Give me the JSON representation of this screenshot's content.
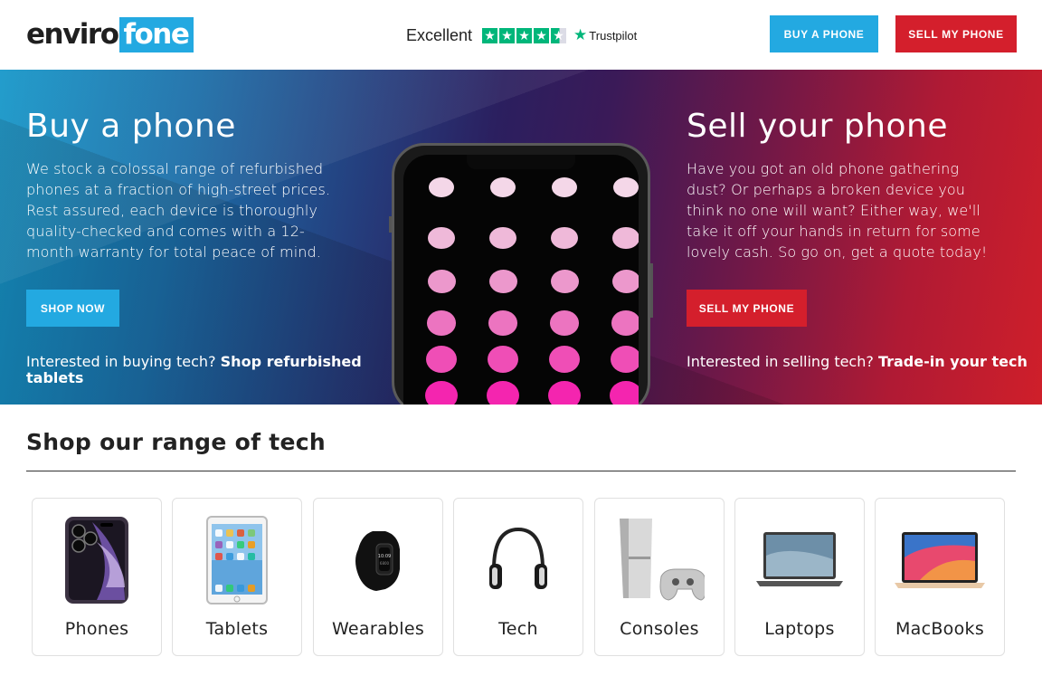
{
  "brand": {
    "logo_part1": "enviro",
    "logo_part2": "fone",
    "accent_blue": "#23a9e1",
    "accent_red": "#d41f2c"
  },
  "trustpilot": {
    "rating_label": "Excellent",
    "stars": 4.5,
    "brand": "Trustpilot",
    "star_color": "#00b67a"
  },
  "header": {
    "buy_button": "BUY A PHONE",
    "sell_button": "SELL MY PHONE"
  },
  "hero": {
    "buy": {
      "title": "Buy a phone",
      "text": "We stock a colossal range of refurbished phones at a fraction of high-street prices. Rest assured, each device is thoroughly quality-checked and comes with a 12-month warranty for total peace of mind.",
      "button": "SHOP NOW",
      "link_prefix": "Interested in buying tech?",
      "link_text": "Shop refurbished tablets"
    },
    "sell": {
      "title": "Sell your phone",
      "text": "Have you got an old phone gathering dust? Or perhaps a broken device you think no one will want? Either way, we'll take it off your hands in return for some lovely cash. So go on, get a quote today!",
      "button": "SELL MY PHONE",
      "link_prefix": "Interested in selling tech?",
      "link_text": "Trade-in your tech"
    }
  },
  "range": {
    "title": "Shop our range of tech",
    "categories": [
      {
        "label": "Phones",
        "icon": "smartphone-icon"
      },
      {
        "label": "Tablets",
        "icon": "tablet-icon"
      },
      {
        "label": "Wearables",
        "icon": "fitness-tracker-icon"
      },
      {
        "label": "Tech",
        "icon": "headphones-icon"
      },
      {
        "label": "Consoles",
        "icon": "game-console-icon"
      },
      {
        "label": "Laptops",
        "icon": "laptop-icon"
      },
      {
        "label": "MacBooks",
        "icon": "macbook-icon"
      }
    ]
  }
}
